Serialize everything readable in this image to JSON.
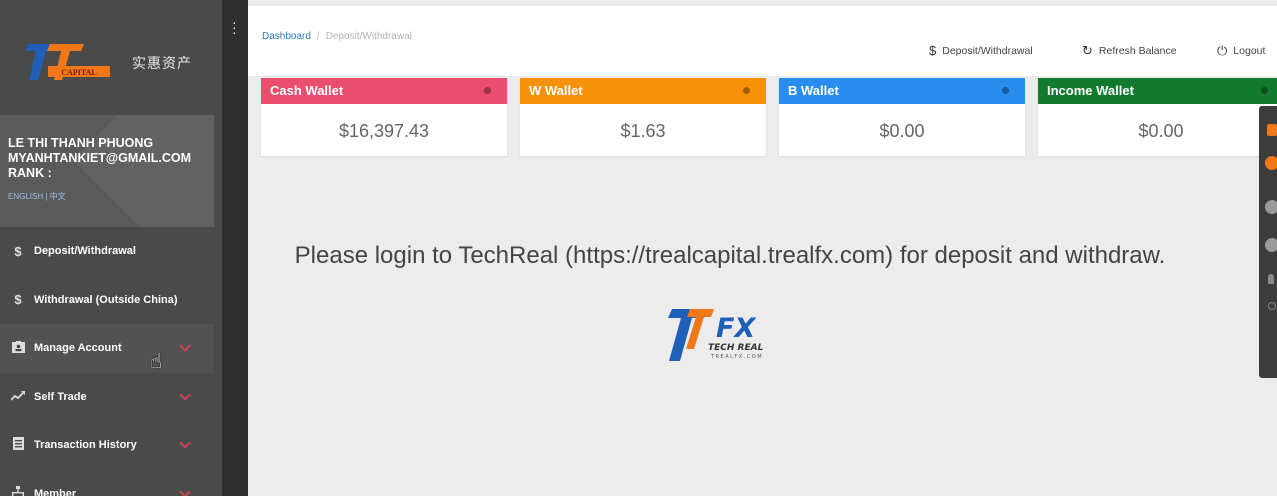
{
  "brand": {
    "logo_text": "CAPITAL",
    "chinese_name": "实惠资产"
  },
  "user": {
    "name": "LE THI THANH PHUONG",
    "email": "MYANHTANKIET@GMAIL.COM",
    "rank": "RANK :",
    "languages": "ENGLISH | 中文"
  },
  "sidebar": {
    "items": [
      {
        "label": "Deposit/Withdrawal",
        "icon": "dollar-icon"
      },
      {
        "label": "Withdrawal (Outside China)",
        "icon": "dollar-icon"
      },
      {
        "label": "Manage Account",
        "icon": "id-card-icon"
      },
      {
        "label": "Self Trade",
        "icon": "trend-icon"
      },
      {
        "label": "Transaction History",
        "icon": "document-icon"
      },
      {
        "label": "Member",
        "icon": "sitemap-icon"
      }
    ]
  },
  "breadcrumb": {
    "home": "Dashboard",
    "separator": "/",
    "current": "Deposit/Withdrawal"
  },
  "header": {
    "deposit_label": "Deposit/Withdrawal",
    "refresh_label": "Refresh Balance",
    "logout_label": "Logout"
  },
  "wallets": [
    {
      "title": "Cash Wallet",
      "value": "$16,397.43",
      "color": "#ea4d6e"
    },
    {
      "title": "W Wallet",
      "value": "$1.63",
      "color": "#f7910a"
    },
    {
      "title": "B Wallet",
      "value": "$0.00",
      "color": "#2a8ef0"
    },
    {
      "title": "Income Wallet",
      "value": "$0.00",
      "color": "#117a2d"
    }
  ],
  "notice": "Please login to TechReal (https://trealcapital.trealfx.com) for deposit and withdraw.",
  "techreal_logo": {
    "fx": "FX",
    "name": "TECH REAL",
    "domain": "TREALFX.COM"
  },
  "colors": {
    "sidebar_bg": "#4a4a4a",
    "accent_red": "#c9484e",
    "brand_blue": "#1b5fb0",
    "brand_orange": "#f07818"
  }
}
